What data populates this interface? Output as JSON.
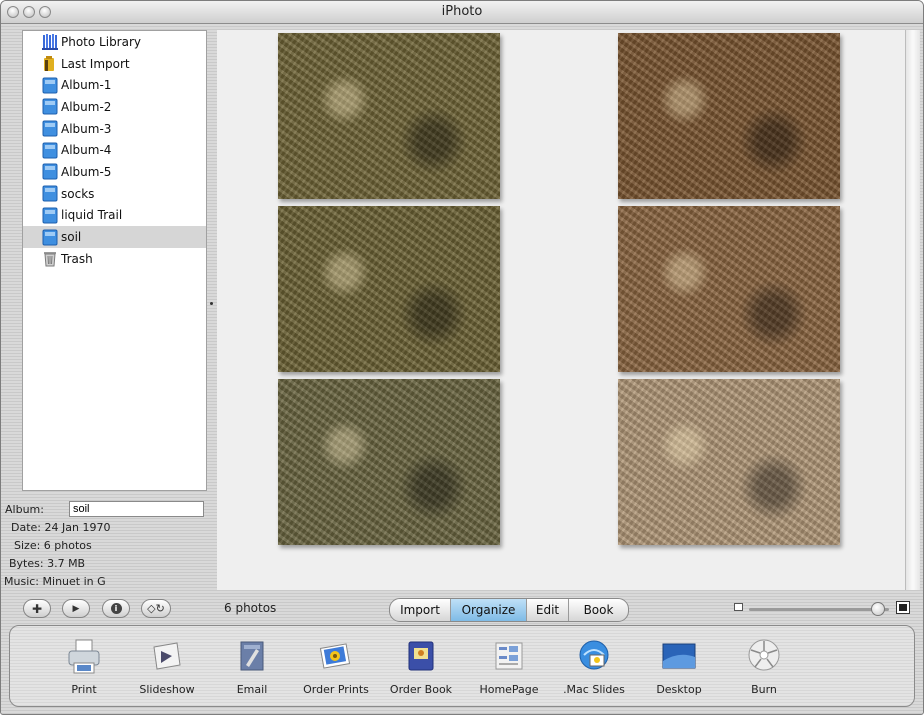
{
  "window": {
    "title": "iPhoto"
  },
  "sidebar": {
    "items": [
      {
        "label": "Photo Library",
        "icon": "photo-library-icon"
      },
      {
        "label": "Last Import",
        "icon": "last-import-icon"
      },
      {
        "label": "Album-1",
        "icon": "album-icon"
      },
      {
        "label": "Album-2",
        "icon": "album-icon"
      },
      {
        "label": "Album-3",
        "icon": "album-icon"
      },
      {
        "label": "Album-4",
        "icon": "album-icon"
      },
      {
        "label": "Album-5",
        "icon": "album-icon"
      },
      {
        "label": "socks",
        "icon": "album-icon"
      },
      {
        "label": "liquid Trail",
        "icon": "album-icon"
      },
      {
        "label": "soil",
        "icon": "album-icon",
        "selected": true
      },
      {
        "label": "Trash",
        "icon": "trash-icon"
      }
    ]
  },
  "info": {
    "album_label": "Album:",
    "album_value": "soil",
    "date_label": "Date:",
    "date_value": "24 Jan 1970",
    "size_label": "Size:",
    "size_value": "6 photos",
    "bytes_label": "Bytes:",
    "bytes_value": "3.7 MB",
    "music_label": "Music:",
    "music_value": "Minuet in G"
  },
  "viewer": {
    "photos": [
      {
        "tone": "#6f6436"
      },
      {
        "tone": "#7a5530"
      },
      {
        "tone": "#6c6234"
      },
      {
        "tone": "#8b6540"
      },
      {
        "tone": "#6a6540"
      },
      {
        "tone": "#b29878"
      }
    ]
  },
  "status": {
    "photo_count": "6 photos"
  },
  "modes": {
    "items": [
      {
        "label": "Import"
      },
      {
        "label": "Organize",
        "active": true
      },
      {
        "label": "Edit"
      },
      {
        "label": "Book"
      }
    ]
  },
  "zoom": {
    "level": 0.92
  },
  "toolbar": {
    "items": [
      {
        "label": "Print",
        "icon": "printer-icon"
      },
      {
        "label": "Slideshow",
        "icon": "slideshow-icon"
      },
      {
        "label": "Email",
        "icon": "email-icon"
      },
      {
        "label": "Order Prints",
        "icon": "order-prints-icon"
      },
      {
        "label": "Order Book",
        "icon": "order-book-icon"
      },
      {
        "label": "HomePage",
        "icon": "homepage-icon"
      },
      {
        "label": ".Mac Slides",
        "icon": "mac-slides-icon"
      },
      {
        "label": "Desktop",
        "icon": "desktop-icon"
      },
      {
        "label": "Burn",
        "icon": "burn-icon"
      }
    ]
  },
  "colors": {
    "selection": "#d6d6d6",
    "mode_active": "#8cc3ea",
    "album_icon": "#3f8fe0"
  }
}
